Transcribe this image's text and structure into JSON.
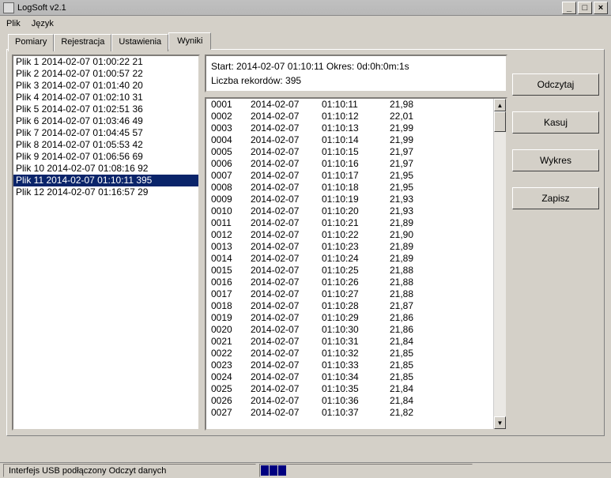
{
  "window": {
    "title": "LogSoft v2.1"
  },
  "menu": {
    "plik": "Plik",
    "jezyk": "Język"
  },
  "tabs": {
    "pomiary": "Pomiary",
    "rejestracja": "Rejestracja",
    "ustawienia": "Ustawienia",
    "wyniki": "Wyniki"
  },
  "filelist": [
    {
      "label": "Plik 1  2014-02-07 01:00:22  21",
      "selected": false
    },
    {
      "label": "Plik 2  2014-02-07 01:00:57  22",
      "selected": false
    },
    {
      "label": "Plik 3  2014-02-07 01:01:40  20",
      "selected": false
    },
    {
      "label": "Plik 4  2014-02-07 01:02:10  31",
      "selected": false
    },
    {
      "label": "Plik 5  2014-02-07 01:02:51  36",
      "selected": false
    },
    {
      "label": "Plik 6  2014-02-07 01:03:46  49",
      "selected": false
    },
    {
      "label": "Plik 7  2014-02-07 01:04:45  57",
      "selected": false
    },
    {
      "label": "Plik 8  2014-02-07 01:05:53  42",
      "selected": false
    },
    {
      "label": "Plik 9  2014-02-07 01:06:56  69",
      "selected": false
    },
    {
      "label": "Plik 10  2014-02-07 01:08:16  92",
      "selected": false
    },
    {
      "label": "Plik 11  2014-02-07 01:10:11  395",
      "selected": true
    },
    {
      "label": "Plik 12  2014-02-07 01:16:57  29",
      "selected": false
    }
  ],
  "info": {
    "line1": "Start: 2014-02-07 01:10:11   Okres: 0d:0h:0m:1s",
    "line2": "Liczba rekordów: 395"
  },
  "records": [
    {
      "id": "0001",
      "date": "2014-02-07",
      "time": "01:10:11",
      "val": "21,98"
    },
    {
      "id": "0002",
      "date": "2014-02-07",
      "time": "01:10:12",
      "val": "22,01"
    },
    {
      "id": "0003",
      "date": "2014-02-07",
      "time": "01:10:13",
      "val": "21,99"
    },
    {
      "id": "0004",
      "date": "2014-02-07",
      "time": "01:10:14",
      "val": "21,99"
    },
    {
      "id": "0005",
      "date": "2014-02-07",
      "time": "01:10:15",
      "val": "21,97"
    },
    {
      "id": "0006",
      "date": "2014-02-07",
      "time": "01:10:16",
      "val": "21,97"
    },
    {
      "id": "0007",
      "date": "2014-02-07",
      "time": "01:10:17",
      "val": "21,95"
    },
    {
      "id": "0008",
      "date": "2014-02-07",
      "time": "01:10:18",
      "val": "21,95"
    },
    {
      "id": "0009",
      "date": "2014-02-07",
      "time": "01:10:19",
      "val": "21,93"
    },
    {
      "id": "0010",
      "date": "2014-02-07",
      "time": "01:10:20",
      "val": "21,93"
    },
    {
      "id": "0011",
      "date": "2014-02-07",
      "time": "01:10:21",
      "val": "21,89"
    },
    {
      "id": "0012",
      "date": "2014-02-07",
      "time": "01:10:22",
      "val": "21,90"
    },
    {
      "id": "0013",
      "date": "2014-02-07",
      "time": "01:10:23",
      "val": "21,89"
    },
    {
      "id": "0014",
      "date": "2014-02-07",
      "time": "01:10:24",
      "val": "21,89"
    },
    {
      "id": "0015",
      "date": "2014-02-07",
      "time": "01:10:25",
      "val": "21,88"
    },
    {
      "id": "0016",
      "date": "2014-02-07",
      "time": "01:10:26",
      "val": "21,88"
    },
    {
      "id": "0017",
      "date": "2014-02-07",
      "time": "01:10:27",
      "val": "21,88"
    },
    {
      "id": "0018",
      "date": "2014-02-07",
      "time": "01:10:28",
      "val": "21,87"
    },
    {
      "id": "0019",
      "date": "2014-02-07",
      "time": "01:10:29",
      "val": "21,86"
    },
    {
      "id": "0020",
      "date": "2014-02-07",
      "time": "01:10:30",
      "val": "21,86"
    },
    {
      "id": "0021",
      "date": "2014-02-07",
      "time": "01:10:31",
      "val": "21,84"
    },
    {
      "id": "0022",
      "date": "2014-02-07",
      "time": "01:10:32",
      "val": "21,85"
    },
    {
      "id": "0023",
      "date": "2014-02-07",
      "time": "01:10:33",
      "val": "21,85"
    },
    {
      "id": "0024",
      "date": "2014-02-07",
      "time": "01:10:34",
      "val": "21,85"
    },
    {
      "id": "0025",
      "date": "2014-02-07",
      "time": "01:10:35",
      "val": "21,84"
    },
    {
      "id": "0026",
      "date": "2014-02-07",
      "time": "01:10:36",
      "val": "21,84"
    },
    {
      "id": "0027",
      "date": "2014-02-07",
      "time": "01:10:37",
      "val": "21,82"
    }
  ],
  "buttons": {
    "odczytaj": "Odczytaj",
    "kasuj": "Kasuj",
    "wykres": "Wykres",
    "zapisz": "Zapisz"
  },
  "status": {
    "left": "Interfejs USB podłączony  Odczyt danych"
  }
}
